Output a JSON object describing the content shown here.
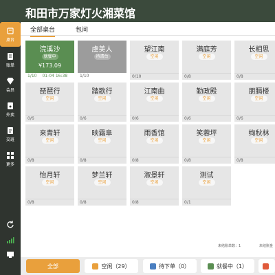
{
  "header": {
    "title": "和田市万家灯火湘菜馆"
  },
  "sidebar": {
    "items": [
      {
        "label": "桌台",
        "icon": "table-icon",
        "active": true
      },
      {
        "label": "账单",
        "icon": "bill-icon"
      },
      {
        "label": "会员",
        "icon": "member-icon"
      },
      {
        "label": "外卖",
        "icon": "takeout-icon"
      },
      {
        "label": "交班",
        "icon": "shift-icon"
      },
      {
        "label": "更多",
        "icon": "more-grid-icon"
      }
    ],
    "bottom_icons": [
      "refresh-icon",
      "signal-icon",
      "monitor-icon"
    ]
  },
  "tabs": [
    {
      "label": "全部桌台",
      "active": true
    },
    {
      "label": "包间",
      "active": false
    }
  ],
  "tables": [
    {
      "name": "浣溪沙",
      "status": "就餐中",
      "state": "dining",
      "amount": "¥173.09",
      "seats": "1/10",
      "time": "01-04 16:38"
    },
    {
      "name": "虞美人",
      "status": "待清台",
      "state": "pending",
      "seats": "1/10"
    },
    {
      "name": "望江南",
      "status": "空闲",
      "state": "free",
      "seats": "0/10"
    },
    {
      "name": "满庭芳",
      "status": "空闲",
      "state": "free",
      "seats": "0/8"
    },
    {
      "name": "长相思",
      "status": "空闲",
      "state": "free",
      "seats": "0/8"
    },
    {
      "name": "琵琶行",
      "status": "空闲",
      "state": "free",
      "seats": "0/6"
    },
    {
      "name": "踏歌行",
      "status": "空闲",
      "state": "free",
      "seats": "0/6"
    },
    {
      "name": "江南曲",
      "status": "空闲",
      "state": "free",
      "seats": "0/6"
    },
    {
      "name": "勤政殿",
      "status": "空闲",
      "state": "free",
      "seats": "0/6"
    },
    {
      "name": "朋膈楼",
      "status": "空闲",
      "state": "free",
      "seats": "0/6"
    },
    {
      "name": "来青轩",
      "status": "空闲",
      "state": "free",
      "seats": "0/8"
    },
    {
      "name": "映霜阜",
      "status": "空闲",
      "state": "free",
      "seats": "0/8"
    },
    {
      "name": "雨香馆",
      "status": "空闲",
      "state": "free",
      "seats": "0/8"
    },
    {
      "name": "笑蓉坪",
      "status": "空闲",
      "state": "free",
      "seats": "0/8"
    },
    {
      "name": "绚秋林",
      "status": "空闲",
      "state": "free",
      "seats": "0/8"
    },
    {
      "name": "怡月轩",
      "status": "空闲",
      "state": "free",
      "seats": "0/8"
    },
    {
      "name": "梦兰轩",
      "status": "空闲",
      "state": "free",
      "seats": "0/8"
    },
    {
      "name": "淑景轩",
      "status": "空闲",
      "state": "free",
      "seats": "0/8"
    },
    {
      "name": "测试",
      "status": "空闲",
      "state": "free",
      "seats": "0/1"
    }
  ],
  "stats": {
    "unsettled_tables": "未结账单数：1",
    "unsettled_amount": "未结账金"
  },
  "filters": [
    {
      "label": "全部",
      "style": "all",
      "icon": ""
    },
    {
      "label": "空闲（29）",
      "style": "plain",
      "icon": "coin-icon",
      "icon_color": "#e9a03c"
    },
    {
      "label": "待下单（0）",
      "style": "plain",
      "icon": "order-icon",
      "icon_color": "#4a7fc1"
    },
    {
      "label": "就餐中（1）",
      "style": "plain",
      "icon": "dining-icon",
      "icon_color": "#5a8e52"
    },
    {
      "label": "",
      "style": "plain",
      "icon": "wallet-icon",
      "icon_color": "#e05a3a"
    }
  ],
  "colors": {
    "accent": "#e9a03c",
    "header_bg": "#3b4a3c",
    "dining_green": "#5a8e52",
    "pending_gray": "#9c9c9c",
    "free_gray": "#e6e6e6"
  }
}
